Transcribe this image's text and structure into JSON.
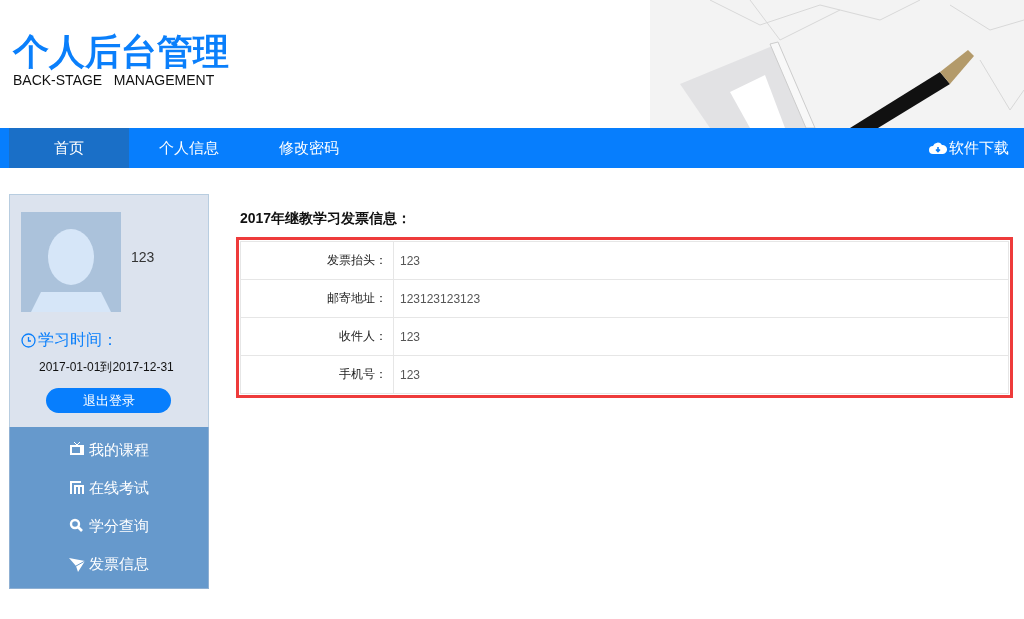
{
  "header": {
    "title": "个人后台管理",
    "subtitle": "BACK-STAGE   MANAGEMENT"
  },
  "nav": {
    "tabs": [
      {
        "label": "首页",
        "selected": true
      },
      {
        "label": "个人信息",
        "selected": false
      },
      {
        "label": "修改密码",
        "selected": false
      }
    ],
    "download": "软件下载"
  },
  "sidebar": {
    "name": "123",
    "time_label": "学习时间：",
    "period": "2017-01-01到2017-12-31",
    "logout": "退出登录",
    "items": [
      {
        "kind": "tv",
        "label": "我的课程"
      },
      {
        "kind": "doc",
        "label": "在线考试"
      },
      {
        "kind": "search",
        "label": "学分查询"
      },
      {
        "kind": "plane",
        "label": "发票信息"
      }
    ]
  },
  "content": {
    "title": "2017年继教学习发票信息：",
    "rows": [
      {
        "label": "发票抬头：",
        "value": "123"
      },
      {
        "label": "邮寄地址：",
        "value": "123123123123"
      },
      {
        "label": "收件人：",
        "value": "123"
      },
      {
        "label": "手机号：",
        "value": "123"
      }
    ]
  }
}
